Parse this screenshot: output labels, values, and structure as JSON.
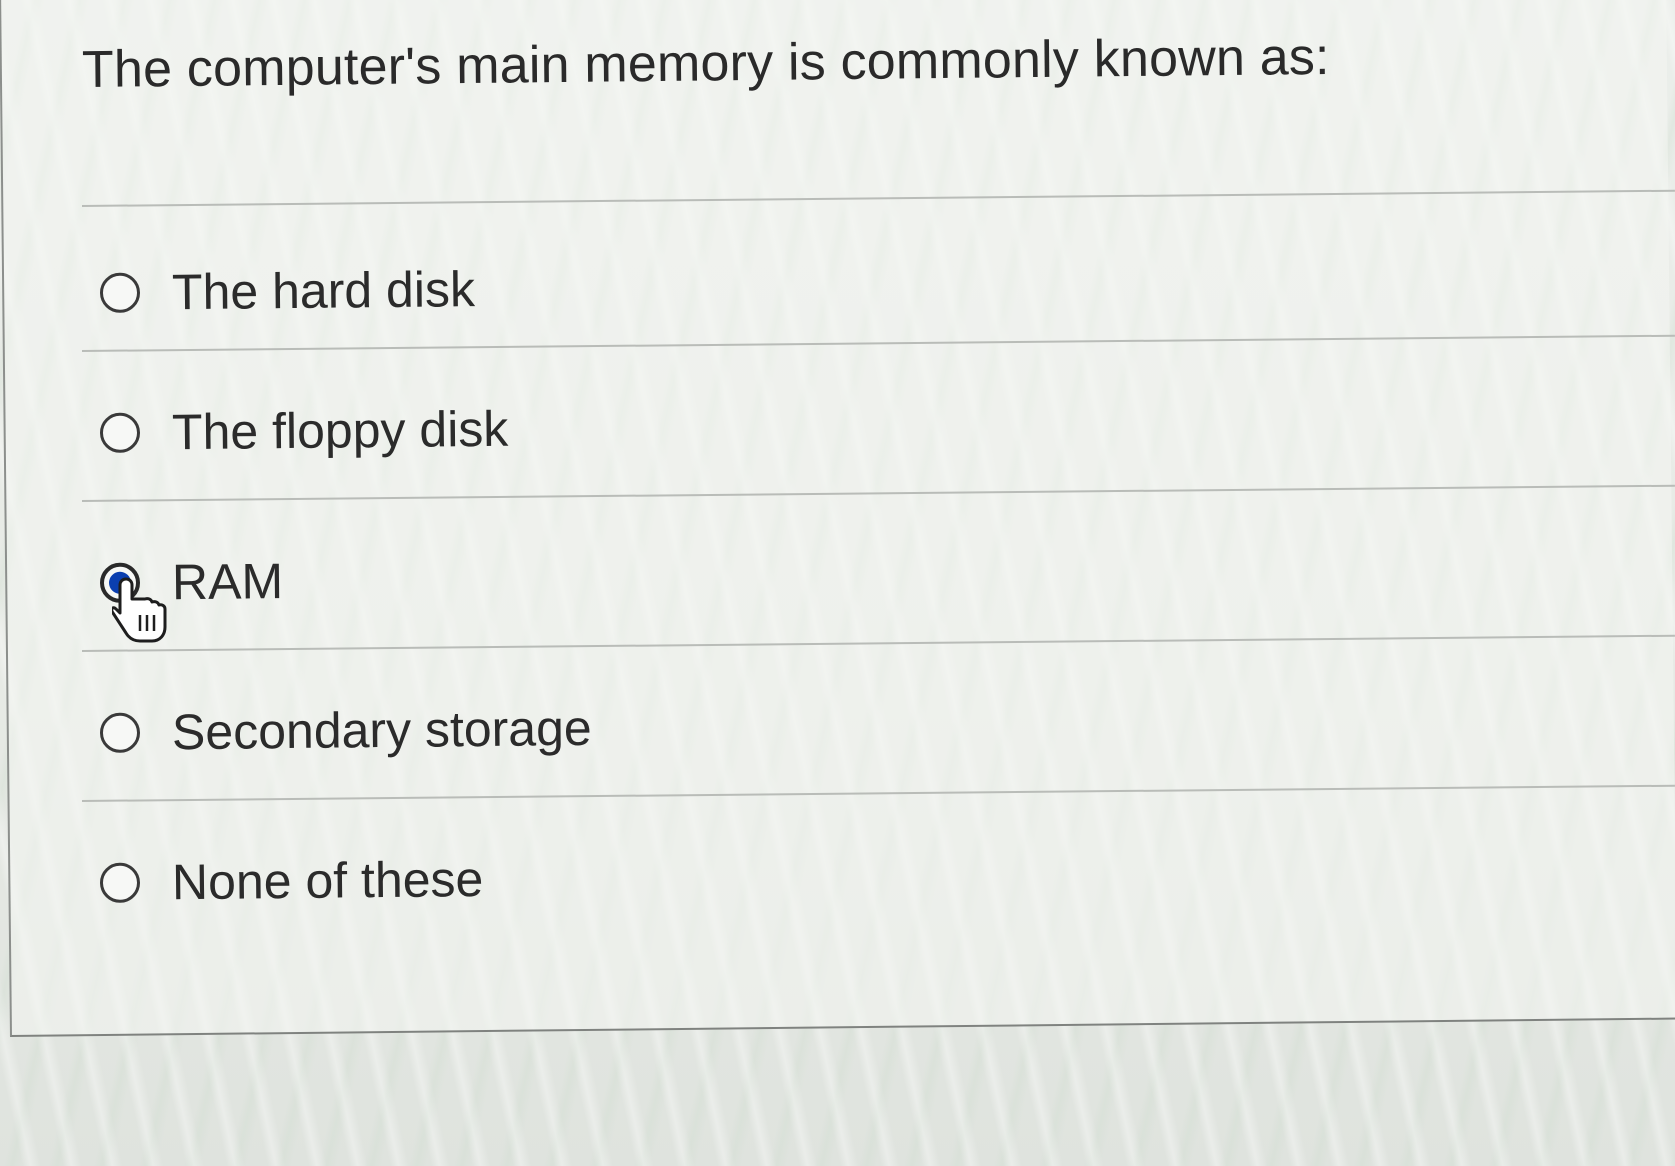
{
  "question": {
    "text": "The computer's main memory is commonly known as:"
  },
  "options": [
    {
      "label": "The hard disk",
      "selected": false
    },
    {
      "label": "The floppy disk",
      "selected": false
    },
    {
      "label": "RAM",
      "selected": true
    },
    {
      "label": "Secondary storage",
      "selected": false
    },
    {
      "label": "None of these",
      "selected": false
    }
  ],
  "colors": {
    "selected_radio": "#0b3fb0",
    "text": "#2b2b2b"
  }
}
